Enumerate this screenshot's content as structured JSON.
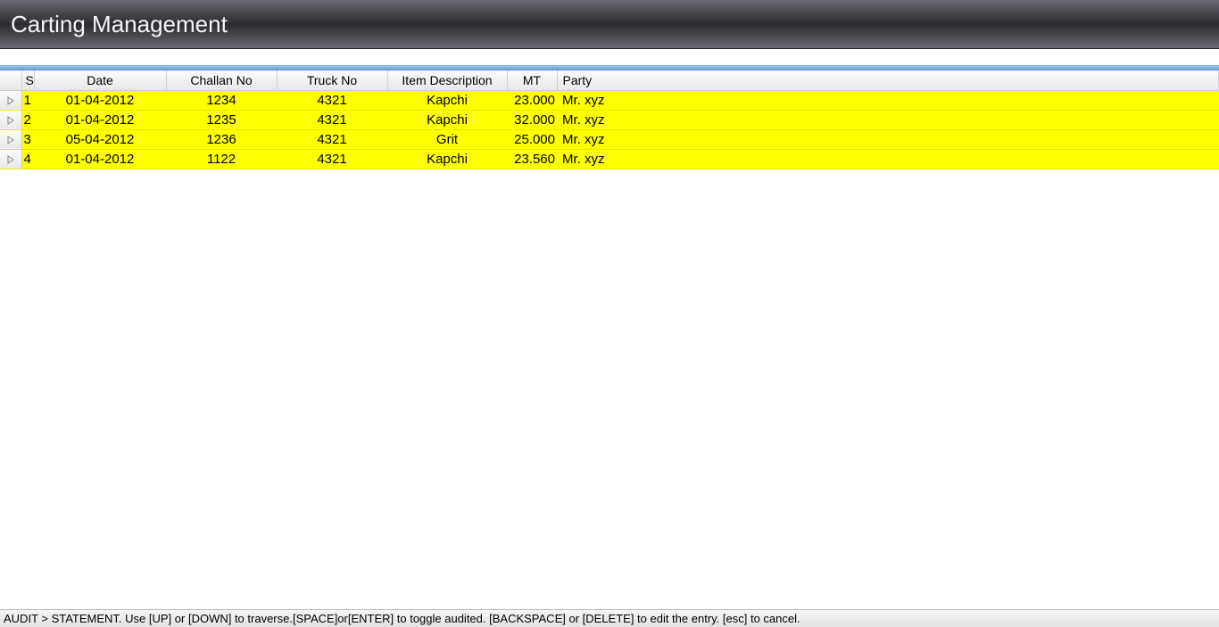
{
  "header": {
    "title": "Carting Management"
  },
  "table": {
    "columns": {
      "sr": "Sr.",
      "date": "Date",
      "challan": "Challan No",
      "truck": "Truck No",
      "item": "Item Description",
      "mt": "MT",
      "party": "Party"
    },
    "rows": [
      {
        "sr": "1",
        "date": "01-04-2012",
        "challan": "1234",
        "truck": "4321",
        "item": "Kapchi",
        "mt": "23.000",
        "party": "Mr. xyz"
      },
      {
        "sr": "2",
        "date": "01-04-2012",
        "challan": "1235",
        "truck": "4321",
        "item": "Kapchi",
        "mt": "32.000",
        "party": "Mr. xyz"
      },
      {
        "sr": "3",
        "date": "05-04-2012",
        "challan": "1236",
        "truck": "4321",
        "item": "Grit",
        "mt": "25.000",
        "party": "Mr. xyz"
      },
      {
        "sr": "4",
        "date": "01-04-2012",
        "challan": "1122",
        "truck": "4321",
        "item": "Kapchi",
        "mt": "23.560",
        "party": "Mr. xyz"
      }
    ]
  },
  "statusbar": {
    "text": "AUDIT > STATEMENT. Use [UP] or [DOWN] to traverse.[SPACE]or[ENTER] to toggle audited. [BACKSPACE] or [DELETE] to edit the entry. [esc] to cancel."
  }
}
